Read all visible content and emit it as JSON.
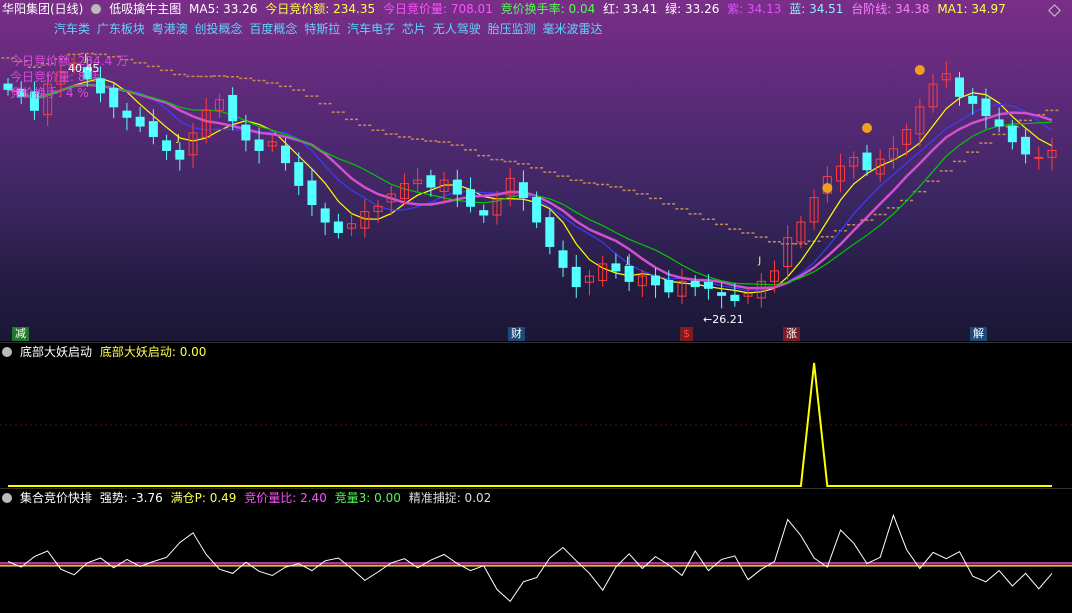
{
  "main": {
    "stock_title": "华阳集团(日线)",
    "formula": "低吸擒牛主图",
    "ma5": "MA5: 33.26",
    "bid_amount": "今日竞价额: 234.35",
    "bid_volume": "今日竞价量: 708.01",
    "bid_turnover": "竞价换手率: 0.04",
    "red": "红: 33.41",
    "green": "绿: 33.26",
    "purple": "紫: 34.13",
    "blue": "蓝: 34.51",
    "step_line": "台阶线: 34.38",
    "ma1": "MA1: 34.97",
    "concepts": [
      "汽车类",
      "广东板块",
      "粤港澳",
      "创投概念",
      "百度概念",
      "特斯拉",
      "汽车电子",
      "芯片",
      "无人驾驶",
      "胎压监测",
      "毫米波雷达"
    ],
    "info_amount": "今日竞价额: 234.4 万",
    "info_volume": "今日竞价量: 8 手",
    "info_turnover": "竞价换手: 4 %",
    "high_label": "40.45",
    "low_label": "←26.21",
    "chips": [
      "减",
      "财",
      "$",
      "涨",
      "解"
    ]
  },
  "mid": {
    "title": "底部大妖启动",
    "value": "底部大妖启动: 0.00"
  },
  "low": {
    "title": "集合竞价快排",
    "strength": "强势: -3.76",
    "full": "满仓P: 0.49",
    "ratio": "竞价量比: 2.40",
    "vol3": "竞量3: 0.00",
    "precise": "精准捕捉: 0.02"
  },
  "colors": {
    "up": "#ff3c3c",
    "down": "#54ffff",
    "ma_yellow": "#ffff00",
    "ma_blue": "#3c3cff",
    "ma_green": "#00c800",
    "ma_purple": "#d050d0",
    "header_yellow": "#ffff50"
  },
  "chart_data": [
    {
      "type": "candlestick",
      "title": "",
      "description": "Daily candlestick chart with moving averages and step line",
      "price_range_visible": [
        26.21,
        40.45
      ],
      "annotations": [
        "40.45",
        "←26.21"
      ],
      "closes": [
        38.6,
        38.2,
        37.4,
        38.9,
        39.6,
        40.1,
        39.2,
        38.4,
        37.6,
        37.0,
        36.5,
        35.9,
        35.1,
        34.6,
        36.1,
        37.4,
        38.0,
        36.8,
        35.7,
        35.1,
        35.6,
        34.4,
        33.1,
        32.0,
        31.0,
        30.4,
        30.9,
        31.6,
        31.9,
        32.6,
        33.2,
        33.4,
        33.0,
        33.4,
        32.6,
        31.9,
        31.4,
        32.3,
        33.5,
        32.4,
        31.0,
        29.6,
        28.4,
        27.3,
        27.9,
        28.6,
        28.2,
        27.6,
        27.9,
        27.4,
        27.0,
        27.6,
        27.3,
        27.2,
        26.8,
        26.5,
        26.9,
        27.6,
        28.2,
        30.1,
        31.0,
        32.4,
        33.6,
        34.2,
        34.7,
        34.0,
        34.6,
        35.2,
        36.3,
        37.6,
        38.9,
        39.5,
        38.2,
        37.8,
        37.1,
        36.5,
        35.6,
        34.9,
        34.7,
        35.1
      ]
    },
    {
      "type": "line",
      "title": "",
      "series": [
        {
          "name": "底部大妖启动",
          "values": [
            0,
            0,
            0,
            0,
            0,
            0,
            0,
            0,
            0,
            0,
            0,
            0,
            0,
            0,
            0,
            0,
            0,
            0,
            0,
            0,
            0,
            0,
            0,
            0,
            0,
            0,
            0,
            0,
            0,
            0,
            0,
            0,
            0,
            0,
            0,
            0,
            0,
            0,
            0,
            0,
            0,
            0,
            0,
            0,
            0,
            0,
            0,
            0,
            0,
            0,
            0,
            0,
            0,
            0,
            0,
            0,
            0,
            0,
            0,
            0,
            0,
            1,
            0,
            0,
            0,
            0,
            0,
            0,
            0,
            0,
            0,
            0,
            0,
            0,
            0,
            0,
            0,
            0,
            0,
            0
          ]
        }
      ],
      "ylim": [
        0,
        1
      ]
    },
    {
      "type": "line",
      "title": "",
      "series": [
        {
          "name": "强势",
          "values": [
            0.5,
            -0.3,
            1.2,
            2.0,
            -0.6,
            -1.4,
            0.3,
            1.0,
            -0.4,
            0.8,
            -0.2,
            0.5,
            1.1,
            3.2,
            4.6,
            1.5,
            -0.6,
            -1.2,
            0.4,
            -0.9,
            -1.5,
            -0.3,
            0.2,
            -0.8,
            0.6,
            1.0,
            -0.5,
            -2.2,
            -1.0,
            0.3,
            0.9,
            -0.4,
            0.7,
            1.5,
            0.2,
            -0.8,
            -0.1,
            -3.5,
            -5.2,
            -2.4,
            -1.8,
            1.0,
            2.5,
            0.6,
            -1.2,
            -3.6,
            -0.3,
            1.6,
            -0.5,
            1.2,
            0.0,
            -1.5,
            2.0,
            -0.8,
            0.8,
            1.3,
            -2.1,
            -0.6,
            0.5,
            6.5,
            4.2,
            1.0,
            -0.3,
            5.0,
            3.1,
            0.2,
            1.1,
            7.1,
            2.2,
            -0.5,
            1.8,
            0.9,
            1.9,
            -1.6,
            -2.4,
            -0.8,
            -3.0,
            -1.2,
            -3.4,
            -1.2
          ]
        }
      ]
    }
  ]
}
